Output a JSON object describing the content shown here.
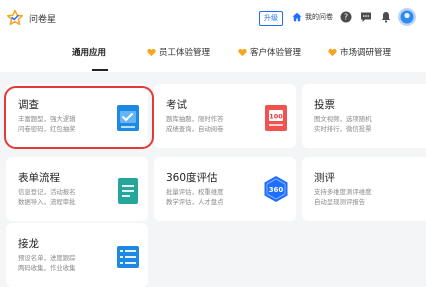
{
  "header": {
    "brand": "问卷星",
    "upgrade_label": "升级",
    "home_label": "我的问卷"
  },
  "tabs": [
    {
      "label": "通用应用"
    },
    {
      "label": "员工体验管理"
    },
    {
      "label": "客户体验管理"
    },
    {
      "label": "市场调研管理"
    }
  ],
  "cards": [
    {
      "title": "调查",
      "line1": "丰富题型，强大逻辑",
      "line2": "问卷密码，红包抽奖"
    },
    {
      "title": "考试",
      "line1": "题库抽题，限时作答",
      "line2": "成绩查询，自动阅卷"
    },
    {
      "title": "投票",
      "line1": "图文视频，选项随机",
      "line2": "实时排行，微信投票"
    },
    {
      "title": "表单流程",
      "line1": "信息登记，活动报名",
      "line2": "数据导入，流程审批"
    },
    {
      "title": "360度评估",
      "line1": "批量评估，权重维度",
      "line2": "教学评估，人才盘点",
      "badge": "360"
    },
    {
      "title": "测评",
      "line1": "支持多维度测评维度",
      "line2": "自动呈现测评报告"
    },
    {
      "title": "接龙",
      "line1": "预设名单，进度跟踪",
      "line2": "两码收集，作业收集"
    }
  ],
  "exam_badge": "100",
  "colors": {
    "accent": "#1e6fff",
    "heart": "#f5a623",
    "selection": "#e53935"
  }
}
